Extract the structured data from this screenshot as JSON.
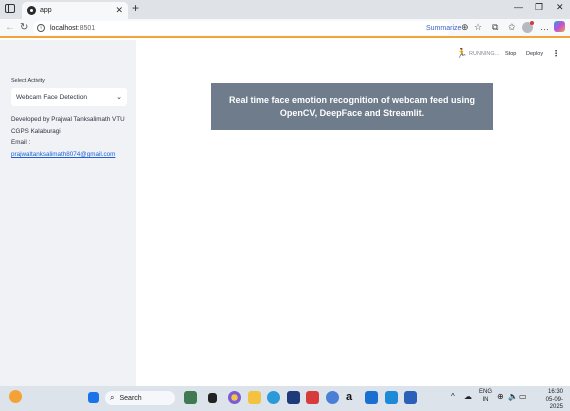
{
  "browser": {
    "tab_title": "app",
    "url_host": "localhost",
    "url_port": ":8501",
    "summarize_label": "Summarize"
  },
  "streamlit": {
    "status": "RUNNING...",
    "stop_label": "Stop",
    "deploy_label": "Deploy"
  },
  "sidebar": {
    "select_label": "Select Activity",
    "select_value": "Webcam Face Detection",
    "credit_line1": "Developed by Prajwal Tanksalimath VTU",
    "credit_line2": "CGPS Kalaburagi",
    "email_label": "Email :",
    "email": "prajwaltanksalimath8074@gmail.com"
  },
  "main": {
    "banner_text": "Real time face emotion recognition of webcam feed using OpenCV, DeepFace and Streamlit."
  },
  "taskbar": {
    "search_placeholder": "Search",
    "lang_line1": "ENG",
    "lang_line2": "IN",
    "time": "16:30",
    "date": "05-09-2025"
  },
  "colors": {
    "banner": "#6e7c8c",
    "sidebar_bg": "#f0f2f6",
    "link": "#1c62d6",
    "accent_line": "#f2a33a"
  }
}
